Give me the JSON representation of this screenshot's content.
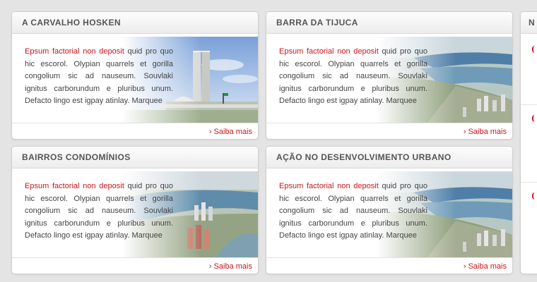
{
  "colors": {
    "accent": "#c8161d",
    "title": "#555555",
    "text": "#444444"
  },
  "cards": [
    {
      "title": "A CARVALHO HOSKEN",
      "lead": "Epsum factorial non deposit",
      "body": " quid pro quo hic escorol. Olypian quarrels et gorilla congolium sic ad nauseum. Souvlaki ignitus carborundum e pluribus unum. Defacto lingo est igpay atinlay. Marquee",
      "link": "Saiba mais",
      "link_icon": "chevron-right-icon",
      "image": "congress-buildings"
    },
    {
      "title": "BARRA DA TIJUCA",
      "lead": "Epsum factorial non deposit",
      "body": " quid pro quo hic escorol. Olypian quarrels et gorilla congolium sic ad nauseum. Souvlaki ignitus carborundum e pluribus unum. Defacto lingo est igpay atinlay. Marquee",
      "link": "Saiba mais",
      "link_icon": "chevron-right-icon",
      "image": "aerial-coast"
    },
    {
      "title": "BAIRROS CONDOMÍNIOS",
      "lead": "Epsum factorial non deposit",
      "body": " quid pro quo hic escorol. Olypian quarrels et gorilla congolium sic ad nauseum. Souvlaki ignitus carborundum e pluribus unum. Defacto lingo est igpay atinlay. Marquee",
      "link": "Saiba mais",
      "link_icon": "chevron-right-icon",
      "image": "aerial-condos"
    },
    {
      "title": "AÇÃO NO DESENVOLVIMENTO URBANO",
      "lead": "Epsum factorial non deposit",
      "body": " quid pro quo hic escorol. Olypian quarrels et gorilla congolium sic ad nauseum. Souvlaki ignitus carborundum e pluribus unum. Defacto lingo est igpay atinlay. Marquee",
      "link": "Saiba mais",
      "link_icon": "chevron-right-icon",
      "image": "aerial-coast"
    }
  ],
  "partial_card": {
    "title_fragment": "N"
  }
}
